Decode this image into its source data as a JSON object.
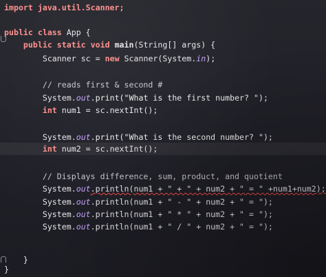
{
  "code": {
    "l1": "import java.util.Scanner;",
    "l2_kw": "public class",
    "l2_rest": " App {",
    "l3_kw1": "public static",
    "l3_kw2": "void",
    "l3_main": "main",
    "l3_rest": "(String[] args) {",
    "l4_type": "Scanner",
    "l4_mid": " sc = ",
    "l4_new": "new",
    "l4_sys": " Scanner(System.",
    "l4_in": "in",
    "l4_end": ");",
    "l6": "// reads first & second #",
    "l7_sys": "System.",
    "l7_out": "out",
    "l7_rest": ".print(\"What is the first number? \");",
    "l8_int": "int",
    "l8_rest": " num1 = sc.nextInt();",
    "l10_sys": "System.",
    "l10_out": "out",
    "l10_rest": ".print(\"What is the second number? \");",
    "l11_int": "int",
    "l11_rest": " num2 = sc.nextInt();",
    "l13": "// Displays difference, sum, product, and quotient",
    "l14_sys": "System.",
    "l14_out": "out",
    "l14_rest": ".println(num1 + \" + \" + num2 + \" = \" +num1+num2);",
    "l15_sys": "System.",
    "l15_out": "out",
    "l15_rest": ".println(num1 + \" - \" + num2 + \" = \");",
    "l16_sys": "System.",
    "l16_out": "out",
    "l16_rest": ".println(num1 + \" * \" + num2 + \" = \");",
    "l17_sys": "System.",
    "l17_out": "out",
    "l17_rest": ".println(num1 + \" / \" + num2 + \" = \");",
    "l20": "}",
    "l21": "}"
  }
}
